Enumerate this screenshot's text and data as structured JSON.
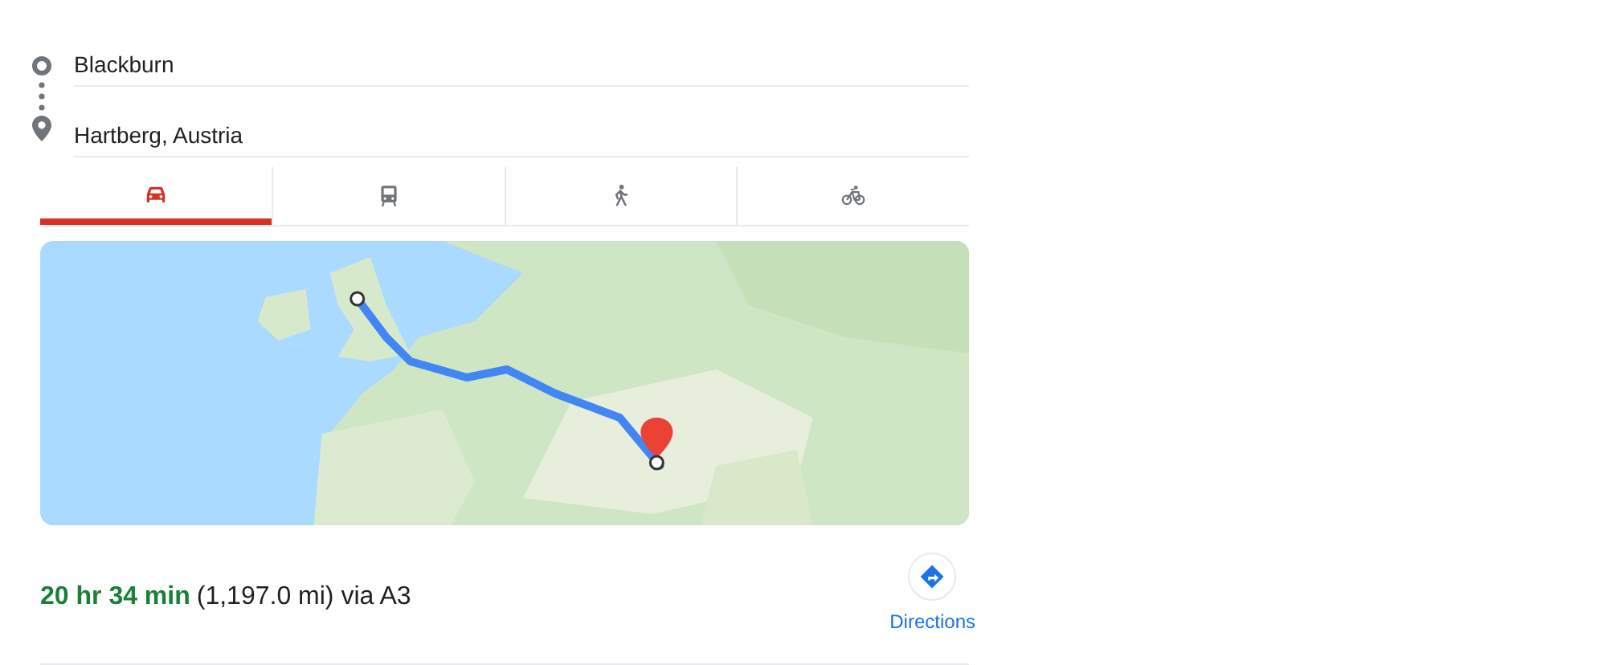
{
  "route": {
    "origin": "Blackburn",
    "destination": "Hartberg, Austria"
  },
  "modes": [
    {
      "kind": "car",
      "selected": true
    },
    {
      "kind": "transit",
      "selected": false
    },
    {
      "kind": "walk",
      "selected": false
    },
    {
      "kind": "bicycle",
      "selected": false
    }
  ],
  "summary": {
    "duration": "20 hr 34 min",
    "details": "(1,197.0 mi) via A3",
    "directions_label": "Directions"
  }
}
